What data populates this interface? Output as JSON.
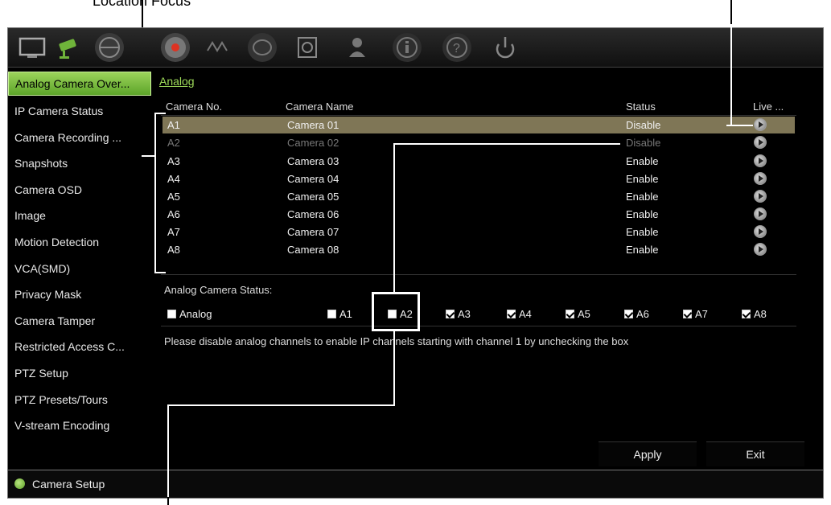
{
  "caption_top": "Location Focus",
  "toolbar": {
    "icons": [
      "monitor-icon",
      "camera-icon",
      "network-icon",
      "record-icon",
      "alarm-icon",
      "hdd-icon",
      "storage-icon",
      "user-icon",
      "info-icon",
      "help-icon",
      "shutdown-icon"
    ]
  },
  "sidebar": {
    "items": [
      {
        "label": "Analog Camera Over..."
      },
      {
        "label": "IP Camera Status"
      },
      {
        "label": "Camera Recording ..."
      },
      {
        "label": "Snapshots"
      },
      {
        "label": "Camera OSD"
      },
      {
        "label": "Image"
      },
      {
        "label": "Motion Detection"
      },
      {
        "label": "VCA(SMD)"
      },
      {
        "label": "Privacy Mask"
      },
      {
        "label": "Camera Tamper"
      },
      {
        "label": "Restricted Access C..."
      },
      {
        "label": "PTZ Setup"
      },
      {
        "label": "PTZ Presets/Tours"
      },
      {
        "label": "V-stream Encoding"
      }
    ]
  },
  "main": {
    "tab": "Analog",
    "headers": {
      "no": "Camera No.",
      "name": "Camera Name",
      "status": "Status",
      "live": "Live ..."
    },
    "rows": [
      {
        "no": "A1",
        "name": "Camera 01",
        "status": "Disable"
      },
      {
        "no": "A2",
        "name": "Camera 02",
        "status": "Disable"
      },
      {
        "no": "A3",
        "name": "Camera 03",
        "status": "Enable"
      },
      {
        "no": "A4",
        "name": "Camera 04",
        "status": "Enable"
      },
      {
        "no": "A5",
        "name": "Camera 05",
        "status": "Enable"
      },
      {
        "no": "A6",
        "name": "Camera 06",
        "status": "Enable"
      },
      {
        "no": "A7",
        "name": "Camera 07",
        "status": "Enable"
      },
      {
        "no": "A8",
        "name": "Camera 08",
        "status": "Enable"
      }
    ],
    "status_label": "Analog Camera Status:",
    "checkboxes": [
      {
        "label": "Analog",
        "checked": false
      },
      {
        "label": "A1",
        "checked": false
      },
      {
        "label": "A2",
        "checked": false
      },
      {
        "label": "A3",
        "checked": true
      },
      {
        "label": "A4",
        "checked": true
      },
      {
        "label": "A5",
        "checked": true
      },
      {
        "label": "A6",
        "checked": true
      },
      {
        "label": "A7",
        "checked": true
      },
      {
        "label": "A8",
        "checked": true
      }
    ],
    "note": "Please disable analog channels to enable IP channels starting with channel 1 by unchecking the box",
    "apply_label": "Apply",
    "exit_label": "Exit"
  },
  "footer": {
    "label": "Camera Setup"
  },
  "colors": {
    "accent": "#7cc24a",
    "selected_row": "#7f7656",
    "tab": "#9fdc5a"
  }
}
